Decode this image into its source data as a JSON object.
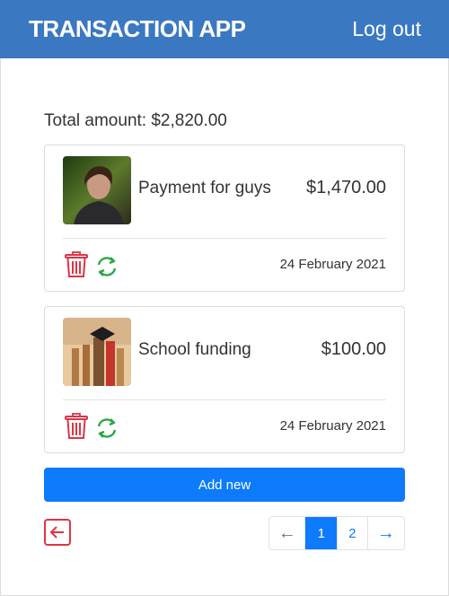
{
  "header": {
    "brand": "TRANSACTION APP",
    "logout_label": "Log out",
    "color": "#3a78c2"
  },
  "summary": {
    "total_text": "Total amount: $2,820.00"
  },
  "transactions": [
    {
      "title": "Payment for guys",
      "amount": "$1,470.00",
      "date": "24 February 2021",
      "thumbnail": "person-photo"
    },
    {
      "title": "School funding",
      "amount": "$100.00",
      "date": "24 February 2021",
      "thumbnail": "graduation-cap-photo"
    }
  ],
  "actions": {
    "add_new_label": "Add new",
    "back_icon": "back-arrow-icon",
    "delete_icon": "trash-icon",
    "refresh_icon": "refresh-icon"
  },
  "pagination": {
    "prev": "←",
    "pages": [
      "1",
      "2"
    ],
    "current": "1",
    "next": "→"
  },
  "colors": {
    "accent": "#0d7bfb",
    "danger": "#dc3545",
    "success": "#28a745"
  }
}
